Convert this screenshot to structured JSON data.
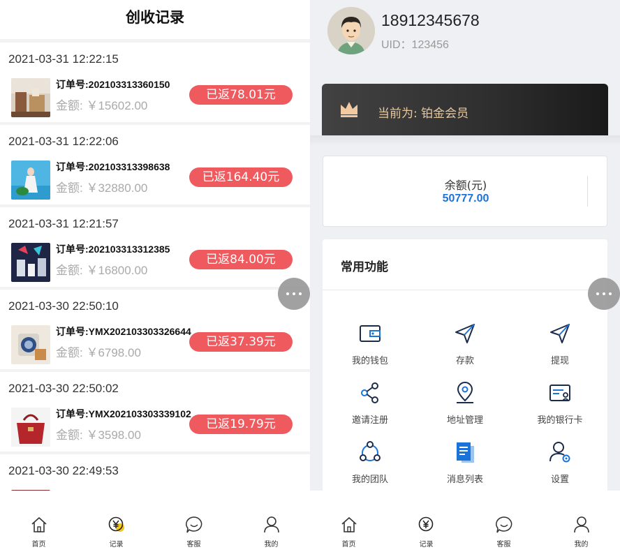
{
  "left": {
    "title": "创收记录",
    "orders": [
      {
        "time": "2021-03-31 12:22:15",
        "order_no": "订单号:202103313360150",
        "amount": "金额:  ￥15602.00",
        "rebate": "已返78.01元"
      },
      {
        "time": "2021-03-31 12:22:06",
        "order_no": "订单号:202103313398638",
        "amount": "金额:  ￥32880.00",
        "rebate": "已返164.40元"
      },
      {
        "time": "2021-03-31 12:21:57",
        "order_no": "订单号:202103313312385",
        "amount": "金额:  ￥16800.00",
        "rebate": "已返84.00元"
      },
      {
        "time": "2021-03-30 22:50:10",
        "order_no": "订单号:YMX202103303326644",
        "amount": "金额:  ￥6798.00",
        "rebate": "已返37.39元"
      },
      {
        "time": "2021-03-30 22:50:02",
        "order_no": "订单号:YMX202103303339102",
        "amount": "金额:  ￥3598.00",
        "rebate": "已返19.79元"
      },
      {
        "time": "2021-03-30 22:49:53"
      }
    ]
  },
  "tabs": [
    {
      "label": "首页",
      "icon": "home-icon"
    },
    {
      "label": "记录",
      "icon": "yuan-record-icon"
    },
    {
      "label": "客服",
      "icon": "smile-chat-icon"
    },
    {
      "label": "我的",
      "icon": "user-icon"
    }
  ],
  "right": {
    "phone": "18912345678",
    "uid": "UID：123456",
    "vip_text": "当前为: 铂金会员",
    "balance_label": "余额(元)",
    "balance_value": "50777.00",
    "functions_title": "常用功能",
    "functions": [
      {
        "label": "我的钱包",
        "icon": "wallet-icon"
      },
      {
        "label": "存款",
        "icon": "send-icon"
      },
      {
        "label": "提现",
        "icon": "send-icon"
      },
      {
        "label": "邀请注册",
        "icon": "share-icon"
      },
      {
        "label": "地址管理",
        "icon": "location-icon"
      },
      {
        "label": "我的银行卡",
        "icon": "bank-card-icon"
      },
      {
        "label": "我的团队",
        "icon": "team-icon"
      },
      {
        "label": "消息列表",
        "icon": "message-list-icon"
      },
      {
        "label": "设置",
        "icon": "settings-user-icon"
      }
    ]
  },
  "colors": {
    "accent": "#1a73d9",
    "rebate": "#ef5a5f",
    "vip_gold": "#e6c9a0",
    "tab_active": "#f5c518"
  }
}
